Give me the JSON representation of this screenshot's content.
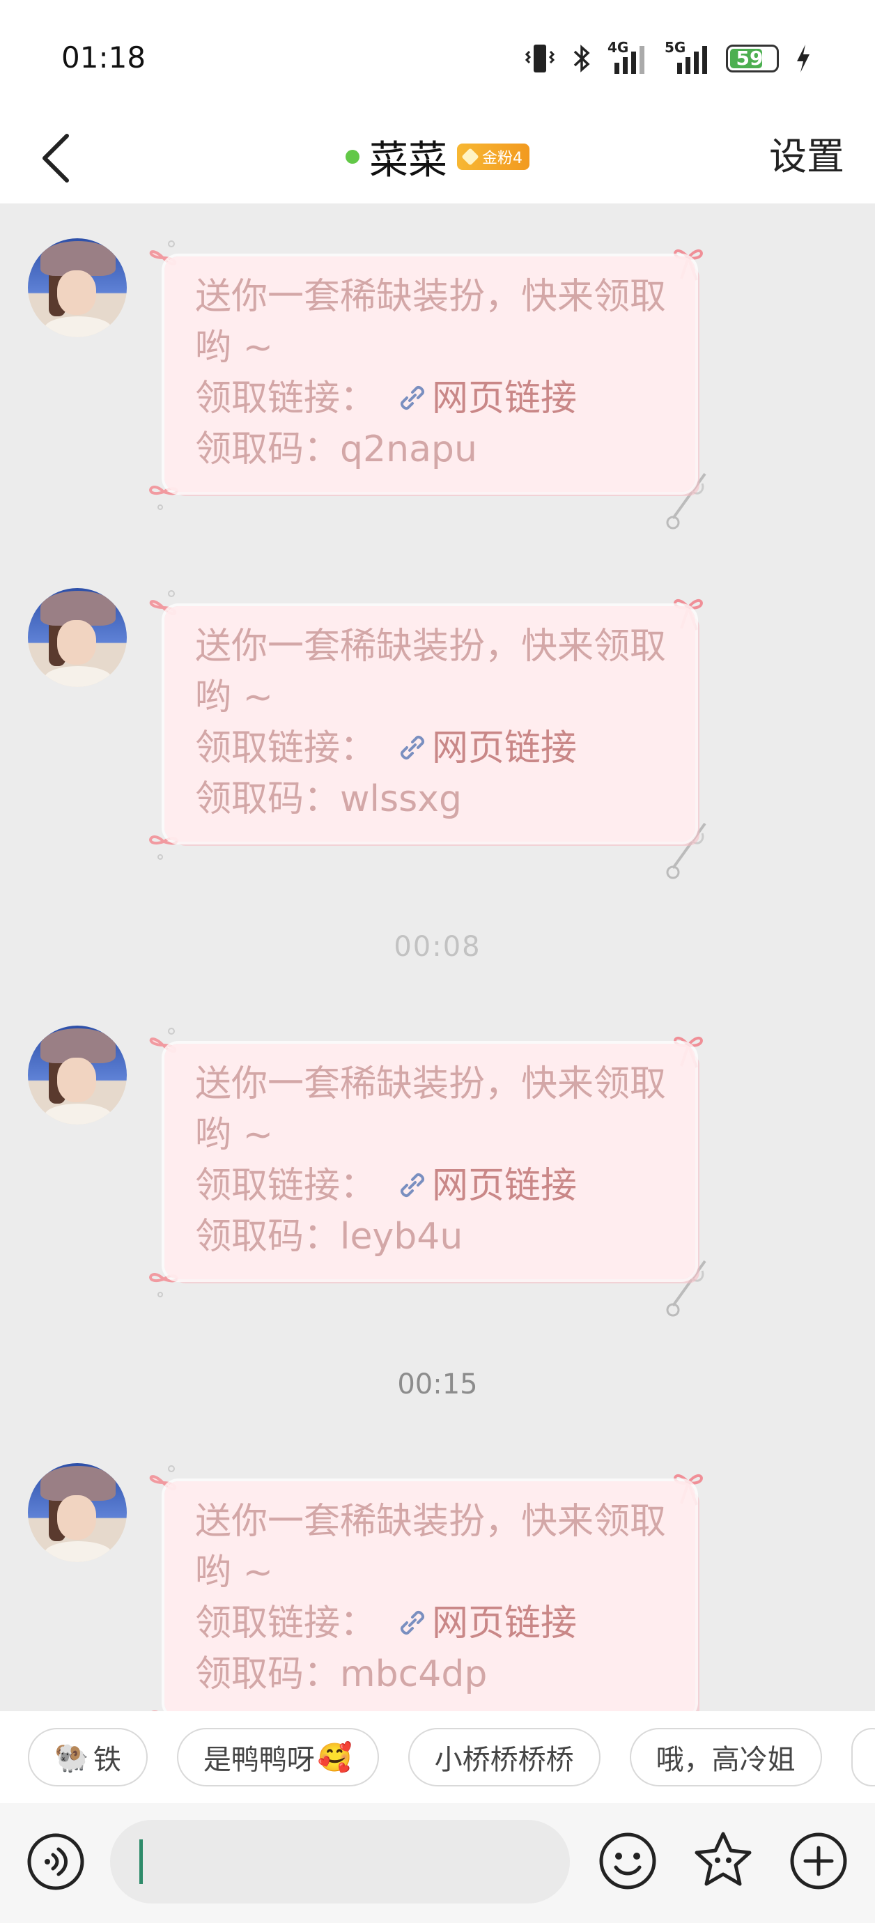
{
  "status_bar": {
    "time": "01:18",
    "battery": "59",
    "network_1": "4G",
    "network_2": "5G"
  },
  "header": {
    "title": "菜菜",
    "badge": "金粉4",
    "settings_label": "设置",
    "online_color": "#62c847"
  },
  "messages": [
    {
      "line1": "送你一套稀缺装扮，快来领取哟 ~",
      "link_prefix": "领取链接：",
      "link_text": "网页链接",
      "code_prefix": "领取码：",
      "code": "q2napu"
    },
    {
      "line1": "送你一套稀缺装扮，快来领取哟 ~",
      "link_prefix": "领取链接：",
      "link_text": "网页链接",
      "code_prefix": "领取码：",
      "code": "wlssxg"
    },
    {
      "line1": "送你一套稀缺装扮，快来领取哟 ~",
      "link_prefix": "领取链接：",
      "link_text": "网页链接",
      "code_prefix": "领取码：",
      "code": "leyb4u"
    },
    {
      "line1": "送你一套稀缺装扮，快来领取哟 ~",
      "link_prefix": "领取链接：",
      "link_text": "网页链接",
      "code_prefix": "领取码：",
      "code": "mbc4dp"
    }
  ],
  "timestamps": {
    "first": "00:08",
    "second": "00:15"
  },
  "quick_replies": [
    {
      "label": "铁",
      "emoji": "🐏"
    },
    {
      "label": "是鸭鸭呀",
      "emoji": "🥰"
    },
    {
      "label": "小桥桥桥桥",
      "emoji": ""
    },
    {
      "label": "哦，高冷姐",
      "emoji": ""
    }
  ],
  "input": {
    "value": ""
  },
  "icons": {
    "back": "chevron-left-icon",
    "voice": "voice-icon",
    "emoji": "smiley-icon",
    "sticker": "star-face-icon",
    "more": "plus-icon"
  },
  "colors": {
    "bubble_bg": "#ffecee",
    "bubble_text": "#d3a7a7",
    "link_text": "#c98787",
    "badge": "#f7b733"
  }
}
